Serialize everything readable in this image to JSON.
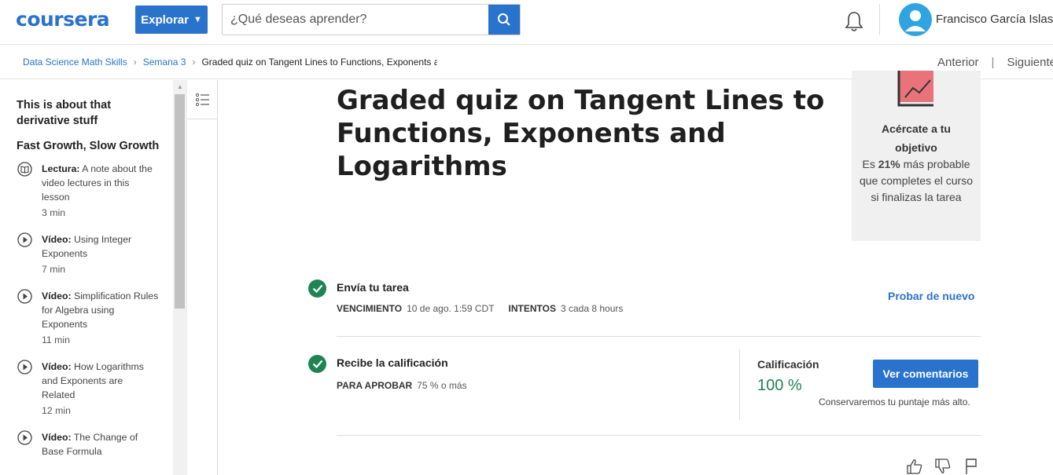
{
  "header": {
    "logo": "coursera",
    "explore_label": "Explorar",
    "search_placeholder": "¿Qué deseas aprender?",
    "user_name": "Francisco García Islas"
  },
  "breadcrumb": {
    "items": [
      "Data Science Math Skills",
      "Semana 3",
      "Graded quiz on Tangent Lines to Functions, Exponents a"
    ],
    "prev_label": "Anterior",
    "next_label": "Siguiente"
  },
  "sidebar": {
    "section1_title": "This is about that derivative stuff",
    "section2_title": "Fast Growth, Slow Growth",
    "items": [
      {
        "type": "Lectura:",
        "title": "A note about the video lectures in this lesson",
        "duration": "3 min",
        "icon": "book-icon"
      },
      {
        "type": "Vídeo:",
        "title": "Using Integer Exponents",
        "duration": "7 min",
        "icon": "play-icon"
      },
      {
        "type": "Vídeo:",
        "title": "Simplification Rules for Algebra using Exponents",
        "duration": "11 min",
        "icon": "play-icon"
      },
      {
        "type": "Vídeo:",
        "title": "How Logarithms and Exponents are Related",
        "duration": "12 min",
        "icon": "play-icon"
      },
      {
        "type": "Vídeo:",
        "title": "The Change of Base Formula",
        "duration": "",
        "icon": "play-icon"
      }
    ]
  },
  "main": {
    "title": "Graded quiz on Tangent Lines to Functions, Exponents and Logarithms",
    "goal": {
      "title": "Acércate a tu objetivo",
      "text_pre": "Es ",
      "percent": "21%",
      "text_post": " más probable que completes el curso si finalizas la tarea"
    },
    "submit": {
      "title": "Envía tu tarea",
      "due_label": "VENCIMIENTO",
      "due_value": "10 de ago. 1:59 CDT",
      "attempts_label": "INTENTOS",
      "attempts_value": "3 cada 8 hours",
      "retry_label": "Probar de nuevo"
    },
    "grade": {
      "title": "Recibe la calificación",
      "pass_label": "PARA APROBAR",
      "pass_value": "75 % o más",
      "grade_label": "Calificación",
      "grade_value": "100 %",
      "feedback_label": "Ver comentarios",
      "keep_note": "Conservaremos tu puntaje más alto."
    }
  },
  "colors": {
    "brand": "#2a73cc",
    "success": "#1f8354"
  }
}
